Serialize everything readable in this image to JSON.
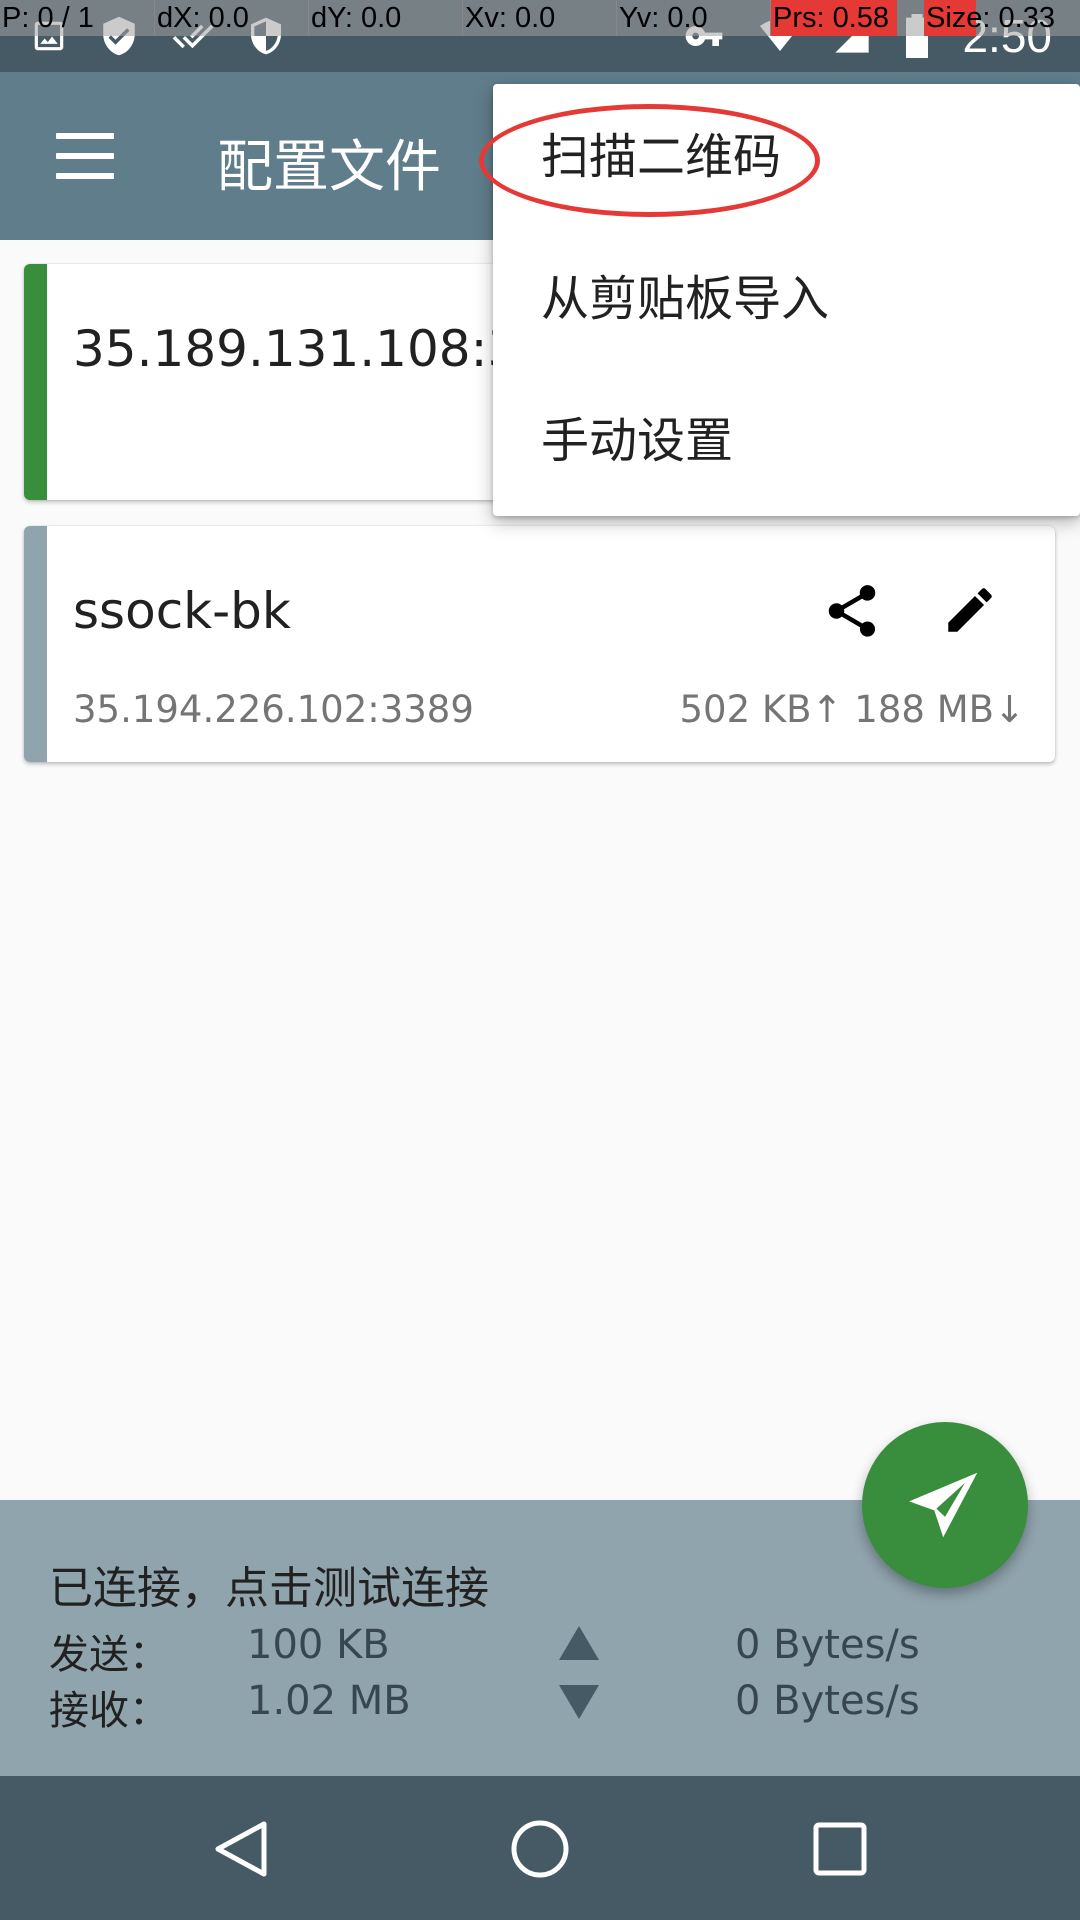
{
  "status_bar": {
    "time": "2:50"
  },
  "debug_overlay": {
    "pointer": "P: 0 / 1",
    "dx": "dX: 0.0",
    "dy": "dY: 0.0",
    "xv": "Xv: 0.0",
    "yv": "Yv: 0.0",
    "pressure": "Prs: 0.58",
    "size": "Size: 0.33"
  },
  "toolbar": {
    "title": "配置文件",
    "menu_icon": "hamburger-menu-icon"
  },
  "profiles": [
    {
      "title": "35.189.131.108:33",
      "active": true,
      "accent": "#388e3c"
    },
    {
      "title": "ssock-bk",
      "address": "35.194.226.102:3389",
      "traffic": "502 KB↑ 188 MB↓",
      "active": false,
      "accent": "#90a4ae"
    }
  ],
  "popup_menu": {
    "items": [
      "扫描二维码",
      "从剪贴板导入",
      "手动设置"
    ],
    "highlighted_index": 0,
    "highlight_color": "#e53935"
  },
  "fab": {
    "icon": "send-paper-plane-icon",
    "color": "#388e3c"
  },
  "connection_panel": {
    "status": "已连接，点击测试连接",
    "send_label": "发送：",
    "send_total": "100 KB",
    "send_rate": "0 Bytes/s",
    "recv_label": "接收：",
    "recv_total": "1.02 MB",
    "recv_rate": "0 Bytes/s"
  },
  "nav_bar": {
    "icons": [
      "back-icon",
      "home-icon",
      "recents-icon"
    ]
  },
  "colors": {
    "primary": "#607d8b",
    "primary_dark": "#455a64",
    "accent": "#388e3c",
    "panel": "#90a4ae"
  }
}
